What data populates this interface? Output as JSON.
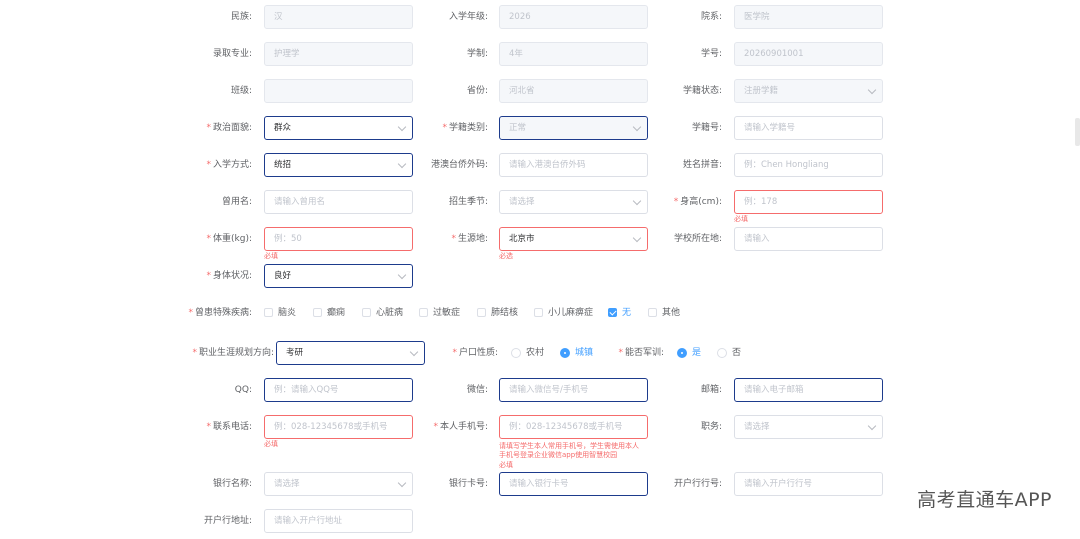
{
  "fields": {
    "ethnicity": {
      "label": "民族:",
      "value": "汉"
    },
    "enroll_grade": {
      "label": "入学年级:",
      "value": "2026"
    },
    "department": {
      "label": "院系:",
      "value": "医学院"
    },
    "major": {
      "label": "录取专业:",
      "value": "护理学"
    },
    "duration": {
      "label": "学制:",
      "value": "4年"
    },
    "student_id": {
      "label": "学号:",
      "value": "20260901001"
    },
    "class": {
      "label": "班级:",
      "value": ""
    },
    "province": {
      "label": "省份:",
      "value": "河北省"
    },
    "status": {
      "label": "学籍状态:",
      "value": "注册学籍"
    },
    "political": {
      "label": "政治面貌:",
      "value": "群众"
    },
    "status_type": {
      "label": "学籍类别:",
      "value": "正常"
    },
    "reg_no": {
      "label": "学籍号:",
      "placeholder": "请输入学籍号"
    },
    "enroll_method": {
      "label": "入学方式:",
      "value": "统招"
    },
    "hk_code": {
      "label": "港澳台侨外码:",
      "placeholder": "请输入港澳台侨外码"
    },
    "pinyin": {
      "label": "姓名拼音:",
      "placeholder": "例：Chen Hongliang"
    },
    "former_name": {
      "label": "曾用名:",
      "placeholder": "请输入曾用名"
    },
    "season": {
      "label": "招生季节:",
      "placeholder": "请选择"
    },
    "height": {
      "label": "身高(cm):",
      "placeholder": "例：178",
      "error": "必填"
    },
    "weight": {
      "label": "体重(kg):",
      "placeholder": "例：50",
      "error": "必填"
    },
    "origin": {
      "label": "生源地:",
      "value": "北京市",
      "error": "必选"
    },
    "school_loc": {
      "label": "学校所在地:",
      "placeholder": "请输入"
    },
    "health": {
      "label": "身体状况:",
      "value": "良好"
    },
    "diseases": {
      "label": "曾患特殊疾病:",
      "options": [
        "脑炎",
        "癫痫",
        "心脏病",
        "过敏症",
        "肺结核",
        "小儿麻痹症",
        "无",
        "其他"
      ],
      "checked": "无"
    },
    "career": {
      "label": "职业生涯规划方向:",
      "value": "考研"
    },
    "hukou": {
      "label": "户口性质:",
      "options": [
        "农村",
        "城镇"
      ],
      "selected": "城镇"
    },
    "military": {
      "label": "能否军训:",
      "options": [
        "是",
        "否"
      ],
      "selected": "是"
    },
    "qq": {
      "label": "QQ:",
      "placeholder": "例：请输入QQ号"
    },
    "wechat": {
      "label": "微信:",
      "placeholder": "请输入微信号/手机号"
    },
    "email": {
      "label": "邮箱:",
      "placeholder": "请输入电子邮箱"
    },
    "contact_phone": {
      "label": "联系电话:",
      "placeholder": "例：028-12345678或手机号",
      "error": "必填"
    },
    "own_phone": {
      "label": "本人手机号:",
      "placeholder": "例：028-12345678或手机号",
      "note_line1": "请填写学生本人常用手机号，学生需使用本人",
      "note_line2": "手机号登录企业微信app使用智慧校园",
      "error": "必填"
    },
    "position": {
      "label": "职务:",
      "placeholder": "请选择"
    },
    "bank_name": {
      "label": "银行名称:",
      "placeholder": "请选择"
    },
    "bank_card": {
      "label": "银行卡号:",
      "placeholder": "请输入银行卡号"
    },
    "bank_branch_no": {
      "label": "开户行行号:",
      "placeholder": "请输入开户行行号"
    },
    "bank_address": {
      "label": "开户行地址:",
      "placeholder": "请输入开户行地址"
    }
  },
  "watermark": "高考直通车APP",
  "colors": {
    "accent": "#409eff",
    "error": "#f56c6c",
    "active_border": "#1d3b8c"
  }
}
